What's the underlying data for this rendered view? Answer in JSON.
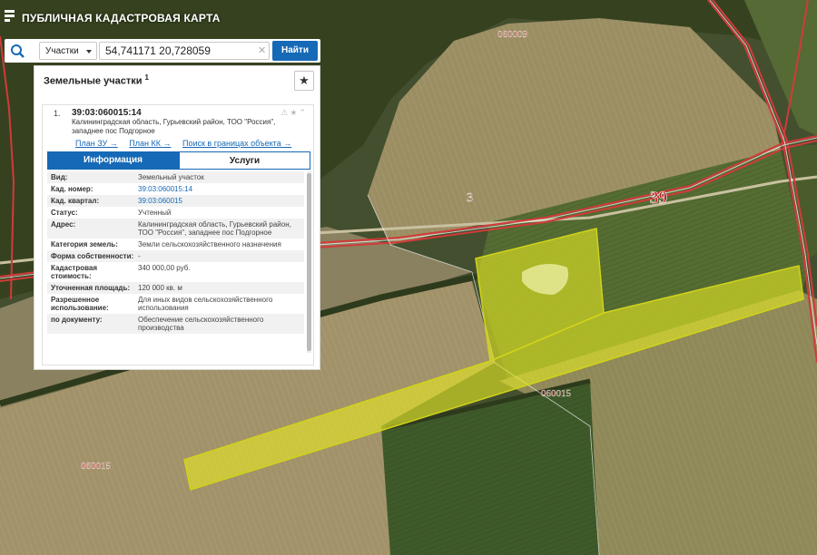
{
  "app": {
    "title": "ПУБЛИЧНАЯ КАДАСТРОВАЯ КАРТА"
  },
  "search": {
    "type_label": "Участки",
    "value": "54,741171 20,728059",
    "find_label": "Найти"
  },
  "panel": {
    "title": "Земельные участки",
    "count": "1",
    "item_index": "1.",
    "cadastral_id": "39:03:060015:14",
    "address_short": "Калининградская область, Гурьевский район, ТОО \"Россия\", западнее пос Подгорное",
    "links": [
      "План ЗУ →",
      "План КК →",
      "Поиск в границах объекта →"
    ],
    "tabs": [
      "Информация",
      "Услуги"
    ],
    "rows": [
      {
        "key": "Вид:",
        "value": "Земельный участок"
      },
      {
        "key": "Кад. номер:",
        "value": "39:03:060015:14",
        "link": true
      },
      {
        "key": "Кад. квартал:",
        "value": "39:03:060015",
        "link": true
      },
      {
        "key": "Статус:",
        "value": "Учтенный"
      },
      {
        "key": "Адрес:",
        "value": "Калининградская область, Гурьевский район, ТОО \"Россия\", западнее пос Подгорное"
      },
      {
        "key": "Категория земель:",
        "value": "Земли сельскохозяйственного назначения"
      },
      {
        "key": "Форма собственности:",
        "value": "-"
      },
      {
        "key": "Кадастровая стоимость:",
        "value": "340 000,00 руб."
      },
      {
        "key": "Уточненная площадь:",
        "value": "120 000 кв. м"
      },
      {
        "key": "Разрешенное использование:",
        "value": "Для иных видов сельскохозяйственного использования"
      },
      {
        "key": "по документу:",
        "value": "Обеспечение сельскохозяйственного производства"
      }
    ]
  },
  "map_labels": {
    "quarter_top": "060009",
    "quarter_mid": "060015",
    "quarter_left": "060015",
    "district": "3",
    "region": "39"
  },
  "colors": {
    "accent": "#1669b6",
    "parcel_fill": "#e3e624",
    "boundary": "#d23a3a"
  }
}
